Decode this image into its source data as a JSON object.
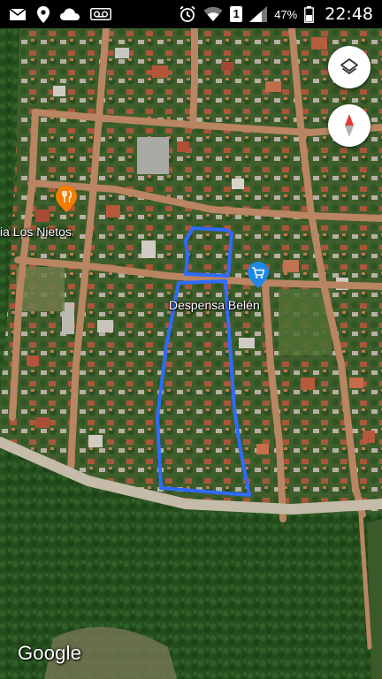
{
  "status_bar": {
    "left_icons": [
      "mail-icon",
      "location-pin-icon",
      "cloud-icon",
      "voicemail-icon"
    ],
    "right_icons": [
      "alarm-icon",
      "wifi-icon",
      "sim-icon",
      "signal-icon",
      "battery-icon"
    ],
    "sim_label": "1",
    "battery_percent": "47%",
    "time": "22:48"
  },
  "map": {
    "poi_labels": {
      "restaurant": "ia Los Nietos",
      "store": "Despensa Belén"
    },
    "poi_icons": {
      "restaurant": "restaurant-pin-icon",
      "store": "shopping-cart-pin-icon"
    },
    "controls": {
      "layers": "layers-icon",
      "compass": "compass-icon"
    },
    "drawn_boundary_color": "#2f6bff",
    "restaurant_pin_color": "#f57c00",
    "store_pin_color": "#1e88e5",
    "compass_needle_color": "#e53935",
    "attribution": "Google"
  }
}
